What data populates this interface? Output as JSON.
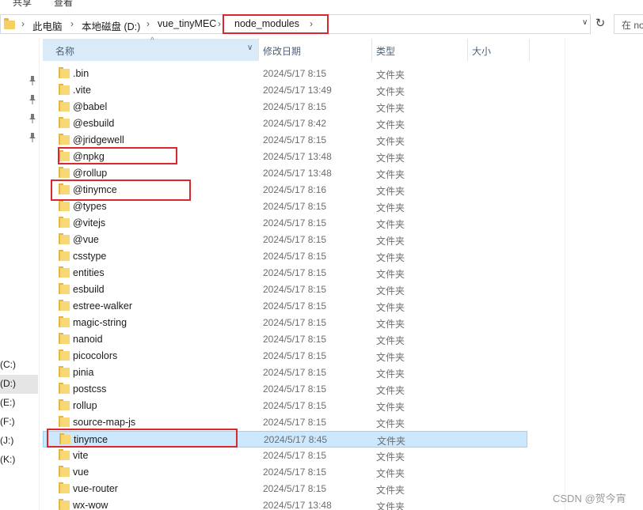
{
  "ribbon": {
    "share": "共享",
    "view": "查看"
  },
  "address": {
    "crumbs": [
      "此电脑",
      "本地磁盘 (D:)",
      "vue_tinyMEC",
      "node_modules"
    ],
    "separator": "›",
    "dropdown": "∨",
    "refresh": "↻",
    "search_placeholder": "在 no"
  },
  "nav": {
    "drives": [
      "(C:)",
      "(D:)",
      "(E:)",
      "(F:)",
      "(J:)",
      "(K:)"
    ],
    "selected_drive": "(D:)"
  },
  "columns": {
    "name": "名称",
    "date": "修改日期",
    "type": "类型",
    "size": "大小",
    "name_dropdown": "∨",
    "sort_arrow": "^"
  },
  "files": [
    {
      "name": ".bin",
      "date": "2024/5/17 8:15",
      "type": "文件夹"
    },
    {
      "name": ".vite",
      "date": "2024/5/17 13:49",
      "type": "文件夹"
    },
    {
      "name": "@babel",
      "date": "2024/5/17 8:15",
      "type": "文件夹"
    },
    {
      "name": "@esbuild",
      "date": "2024/5/17 8:42",
      "type": "文件夹"
    },
    {
      "name": "@jridgewell",
      "date": "2024/5/17 8:15",
      "type": "文件夹"
    },
    {
      "name": "@npkg",
      "date": "2024/5/17 13:48",
      "type": "文件夹"
    },
    {
      "name": "@rollup",
      "date": "2024/5/17 13:48",
      "type": "文件夹"
    },
    {
      "name": "@tinymce",
      "date": "2024/5/17 8:16",
      "type": "文件夹"
    },
    {
      "name": "@types",
      "date": "2024/5/17 8:15",
      "type": "文件夹"
    },
    {
      "name": "@vitejs",
      "date": "2024/5/17 8:15",
      "type": "文件夹"
    },
    {
      "name": "@vue",
      "date": "2024/5/17 8:15",
      "type": "文件夹"
    },
    {
      "name": "csstype",
      "date": "2024/5/17 8:15",
      "type": "文件夹"
    },
    {
      "name": "entities",
      "date": "2024/5/17 8:15",
      "type": "文件夹"
    },
    {
      "name": "esbuild",
      "date": "2024/5/17 8:15",
      "type": "文件夹"
    },
    {
      "name": "estree-walker",
      "date": "2024/5/17 8:15",
      "type": "文件夹"
    },
    {
      "name": "magic-string",
      "date": "2024/5/17 8:15",
      "type": "文件夹"
    },
    {
      "name": "nanoid",
      "date": "2024/5/17 8:15",
      "type": "文件夹"
    },
    {
      "name": "picocolors",
      "date": "2024/5/17 8:15",
      "type": "文件夹"
    },
    {
      "name": "pinia",
      "date": "2024/5/17 8:15",
      "type": "文件夹"
    },
    {
      "name": "postcss",
      "date": "2024/5/17 8:15",
      "type": "文件夹"
    },
    {
      "name": "rollup",
      "date": "2024/5/17 8:15",
      "type": "文件夹"
    },
    {
      "name": "source-map-js",
      "date": "2024/5/17 8:15",
      "type": "文件夹"
    },
    {
      "name": "tinymce",
      "date": "2024/5/17 8:45",
      "type": "文件夹"
    },
    {
      "name": "vite",
      "date": "2024/5/17 8:15",
      "type": "文件夹"
    },
    {
      "name": "vue",
      "date": "2024/5/17 8:15",
      "type": "文件夹"
    },
    {
      "name": "vue-router",
      "date": "2024/5/17 8:15",
      "type": "文件夹"
    },
    {
      "name": "wx-wow",
      "date": "2024/5/17 13:48",
      "type": "文件夹"
    }
  ],
  "selected_file": "tinymce",
  "highlighted_files": [
    "@npkg",
    "@tinymce",
    "tinymce"
  ],
  "highlight_color": "#d9272e",
  "selection_color": "#cce8ff",
  "watermark": "CSDN @贺今宵"
}
